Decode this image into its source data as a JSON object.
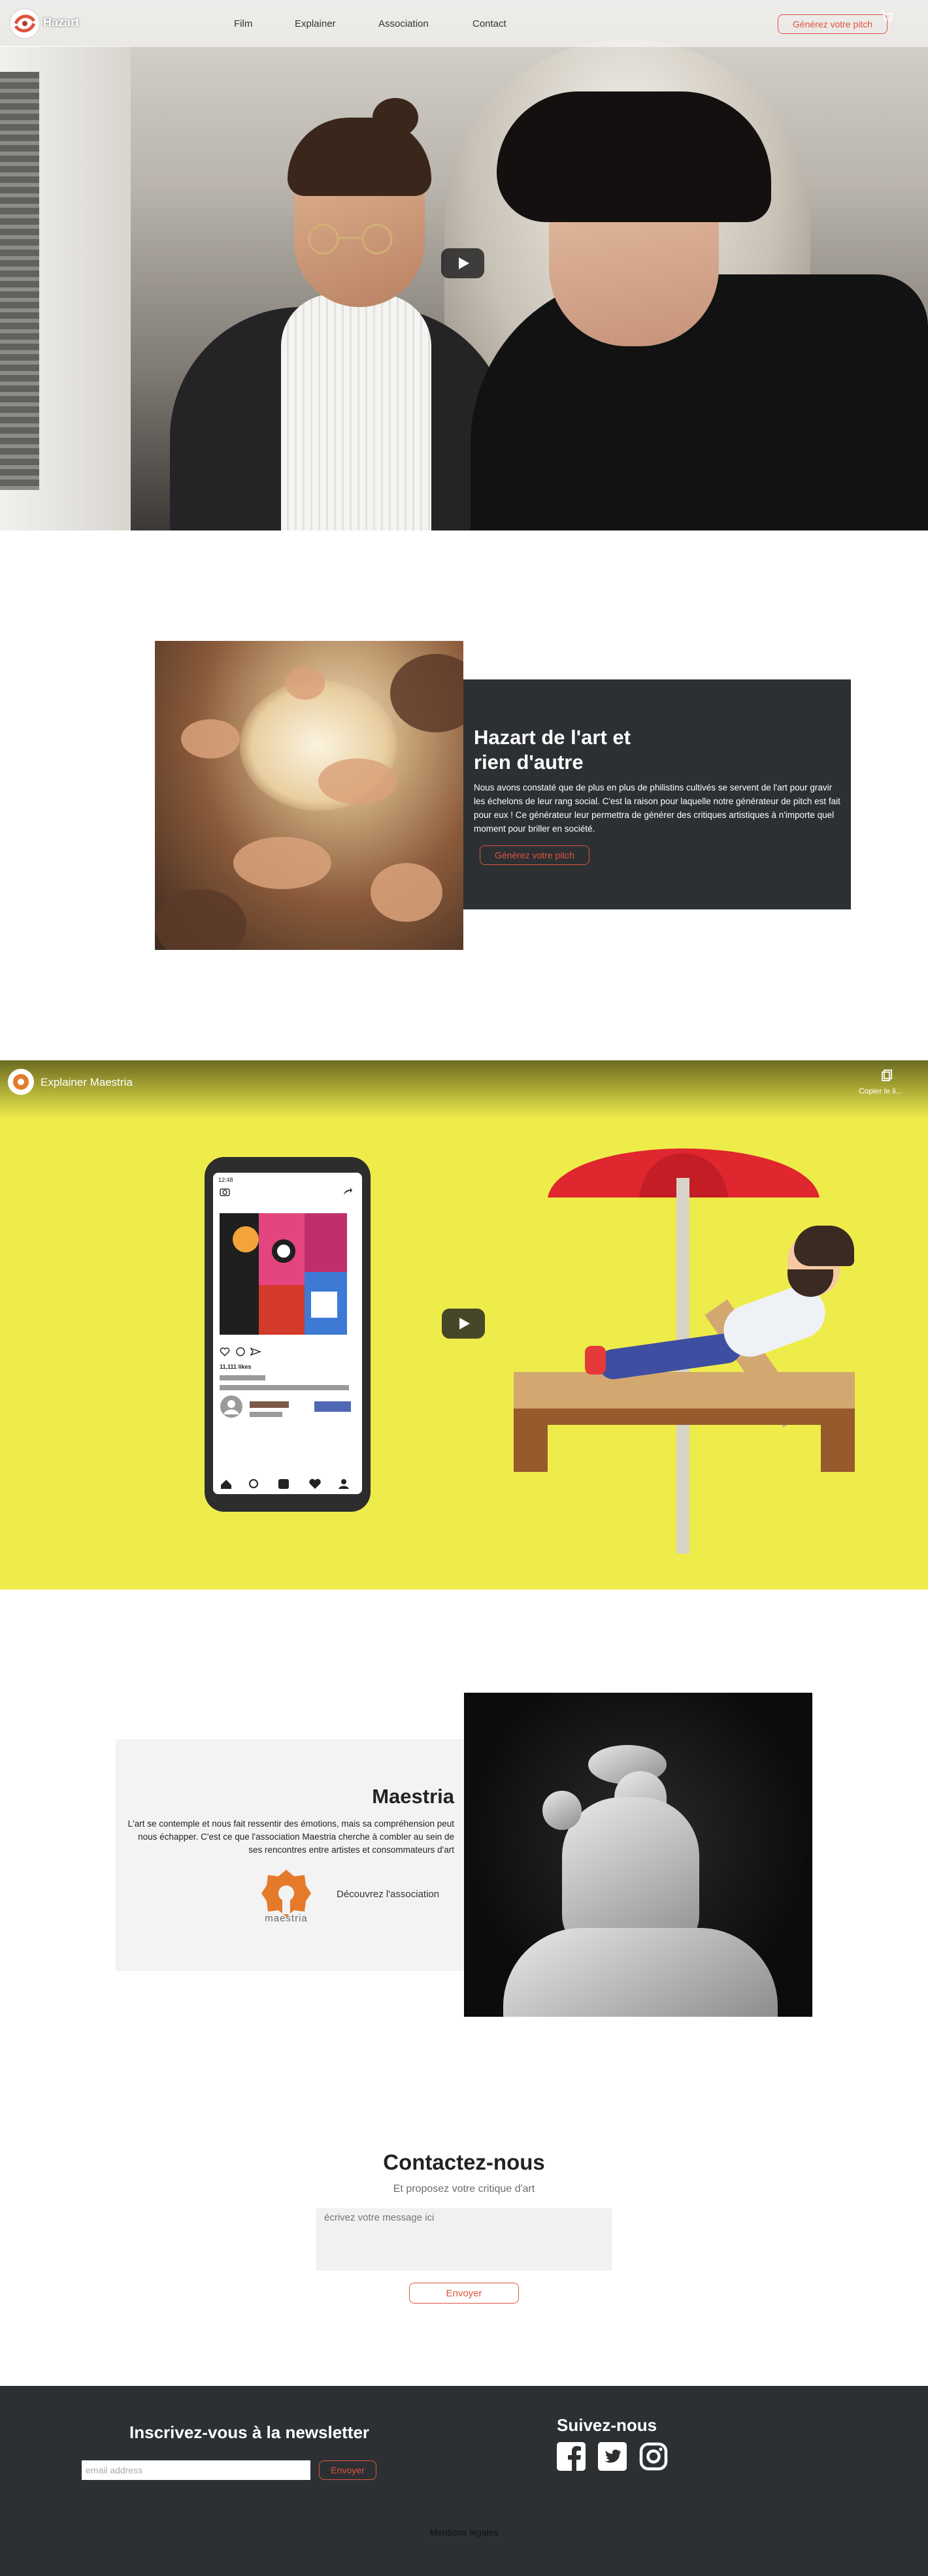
{
  "header": {
    "logo_text": "Hazart",
    "nav": [
      "Film",
      "Explainer",
      "Association",
      "Contact"
    ],
    "cta_label": "Générez votre pitch",
    "brand_color": "#e0533f"
  },
  "hero": {
    "media": "video",
    "play_icon": "play-icon"
  },
  "hazart": {
    "title_line1": "Hazart de l'art et",
    "title_line2": "rien d'autre",
    "body": "Nous avons constaté que de plus en plus de philistins cultivés se servent de l'art pour gravir les échelons de leur rang social. C'est la raison pour laquelle notre générateur de pitch est fait pour eux ! Ce générateur leur permettra de générer des critiques artistiques à n'importe quel moment pour briller en société.",
    "cta_label": "Générez votre pitch",
    "card_color": "#2c3033"
  },
  "explainer": {
    "video_title": "Explainer Maestria",
    "copy_label": "Copier le li...",
    "phone_time": "12:48",
    "likes_text": "11,111 likes",
    "background_color": "#eeec4a"
  },
  "maestria": {
    "title": "Maestria",
    "body": "L'art se contemple et nous fait ressentir des émotions, mais sa compréhension peut nous échapper. C'est ce que l'association Maestria cherche à combler au sein de ses rencontres entre artistes et consommateurs d'art",
    "logo_word": "maestria",
    "link_label": "Découvrez l'association"
  },
  "contact": {
    "title": "Contactez-nous",
    "subtitle": "Et proposez votre critique d'art",
    "placeholder": "écrivez votre message ici",
    "submit_label": "Envoyer"
  },
  "footer": {
    "newsletter_title": "Inscrivez-vous à la newsletter",
    "email_placeholder": "email address",
    "newsletter_button": "Envoyer",
    "follow_title": "Suivez-nous",
    "social_icons": [
      "facebook-icon",
      "twitter-icon",
      "instagram-icon"
    ],
    "legal_label": "Mentions légales"
  }
}
